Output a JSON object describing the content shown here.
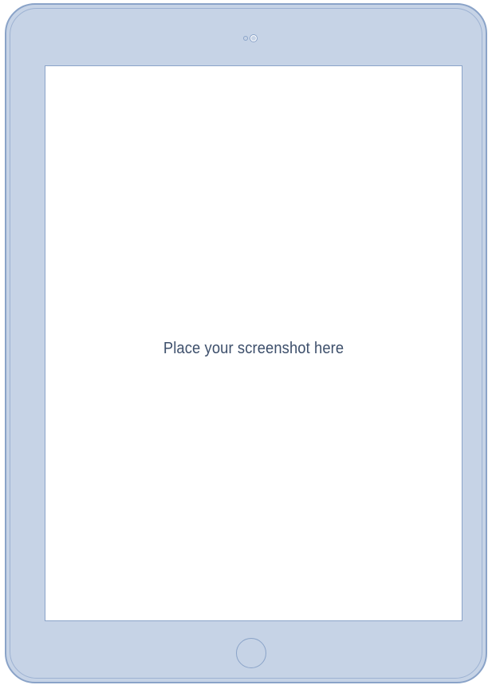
{
  "device": {
    "type": "tablet",
    "frame_color": "#c6d3e6",
    "outline_color": "#8aa3c8"
  },
  "screen": {
    "placeholder_text": "Place your screenshot here",
    "text_color": "#3d4f6b",
    "background": "#ffffff"
  },
  "icons": {
    "camera": "front-camera-icon",
    "sensor": "light-sensor-icon",
    "home": "home-button-icon"
  }
}
